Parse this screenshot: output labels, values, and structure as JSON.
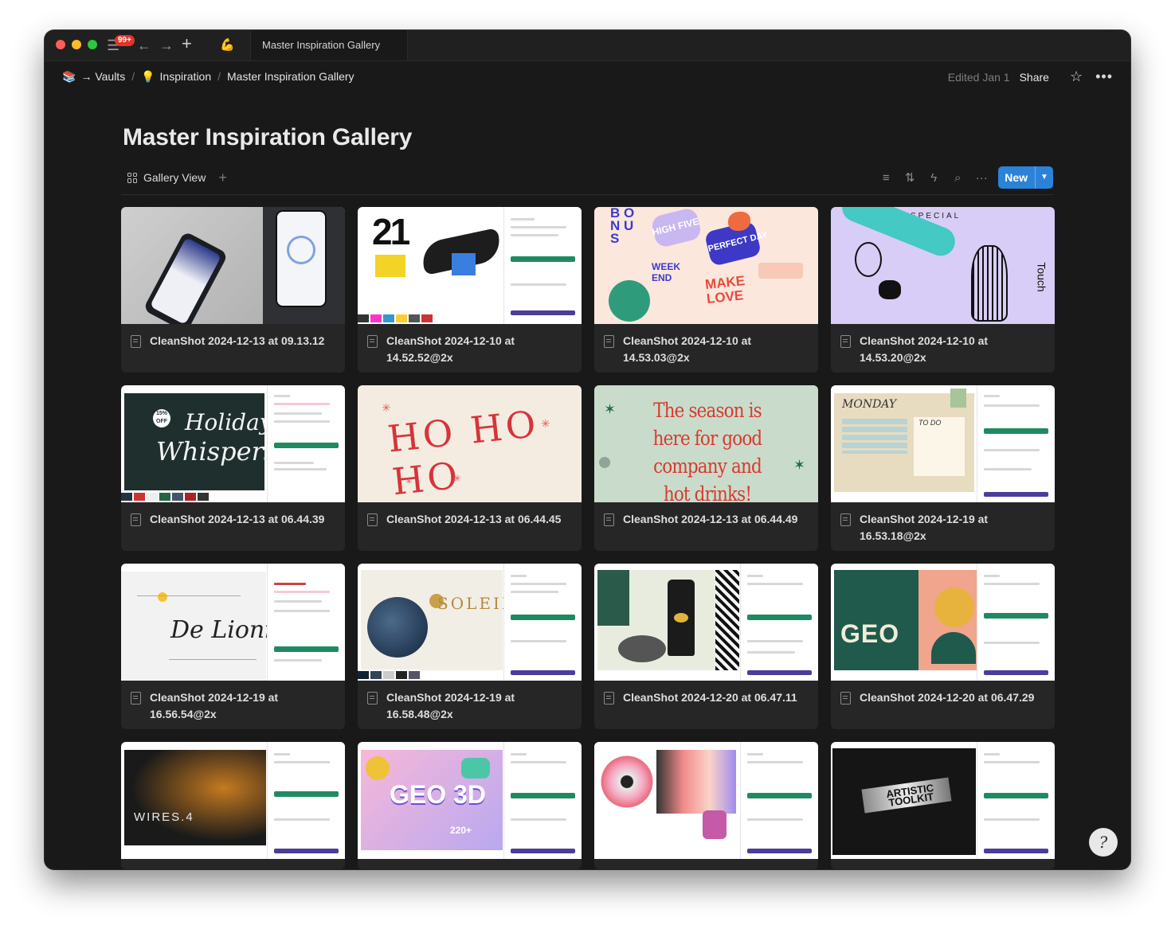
{
  "window": {
    "tab_title": "Master Inspiration Gallery",
    "notification_badge": "99+"
  },
  "breadcrumb": {
    "items": [
      {
        "icon": "books-icon",
        "label": "→ Vaults"
      },
      {
        "icon": "lightbulb-icon",
        "label": "Inspiration"
      },
      {
        "icon": "",
        "label": "Master Inspiration Gallery"
      }
    ]
  },
  "header": {
    "edited": "Edited Jan 1",
    "share": "Share"
  },
  "page": {
    "title": "Master Inspiration Gallery"
  },
  "view": {
    "label": "Gallery View",
    "new_button": "New"
  },
  "cards": [
    {
      "title": "CleanShot 2024-12-13 at 09.13.12"
    },
    {
      "title": "CleanShot 2024-12-10 at 14.52.52@2x"
    },
    {
      "title": "CleanShot 2024-12-10 at 14.53.03@2x"
    },
    {
      "title": "CleanShot 2024-12-10 at 14.53.20@2x"
    },
    {
      "title": "CleanShot 2024-12-13 at 06.44.39"
    },
    {
      "title": "CleanShot 2024-12-13 at 06.44.45"
    },
    {
      "title": "CleanShot 2024-12-13 at 06.44.49"
    },
    {
      "title": "CleanShot 2024-12-19 at 16.53.18@2x"
    },
    {
      "title": "CleanShot 2024-12-19 at 16.56.54@2x"
    },
    {
      "title": "CleanShot 2024-12-19 at 16.58.48@2x"
    },
    {
      "title": "CleanShot 2024-12-20 at 06.47.11"
    },
    {
      "title": "CleanShot 2024-12-20 at 06.47.29"
    },
    {
      "title": ""
    },
    {
      "title": ""
    },
    {
      "title": ""
    },
    {
      "title": ""
    }
  ],
  "thumb_text": {
    "t2_num": "21",
    "t3_a": "B O\nN U\nS",
    "t3_b": "HIGH FIVE",
    "t3_c": "PERFECT DAY",
    "t3_d": "WEEK END",
    "t3_e": "MAKE LOVE",
    "t4_a": "SPECIAL",
    "t4_b": "Touch",
    "t5_a": "Holiday",
    "t5_b": "Whispers",
    "t5_c": "15% OFF",
    "t6": "HO HO HO",
    "t7": "The season is here for good company and hot drinks!",
    "t8_a": "MONDAY",
    "t8_b": "TO DO",
    "t9": "De Lionist",
    "t10": "SOLEIL",
    "t12": "GEO",
    "t13": "WIRES.4",
    "t14_a": "GEO 3D",
    "t14_b": "220+",
    "t16": "ARTISTIC TOOLKIT"
  },
  "colors": {
    "accent": "#2a83d8",
    "background": "#191919",
    "card": "#262626"
  }
}
